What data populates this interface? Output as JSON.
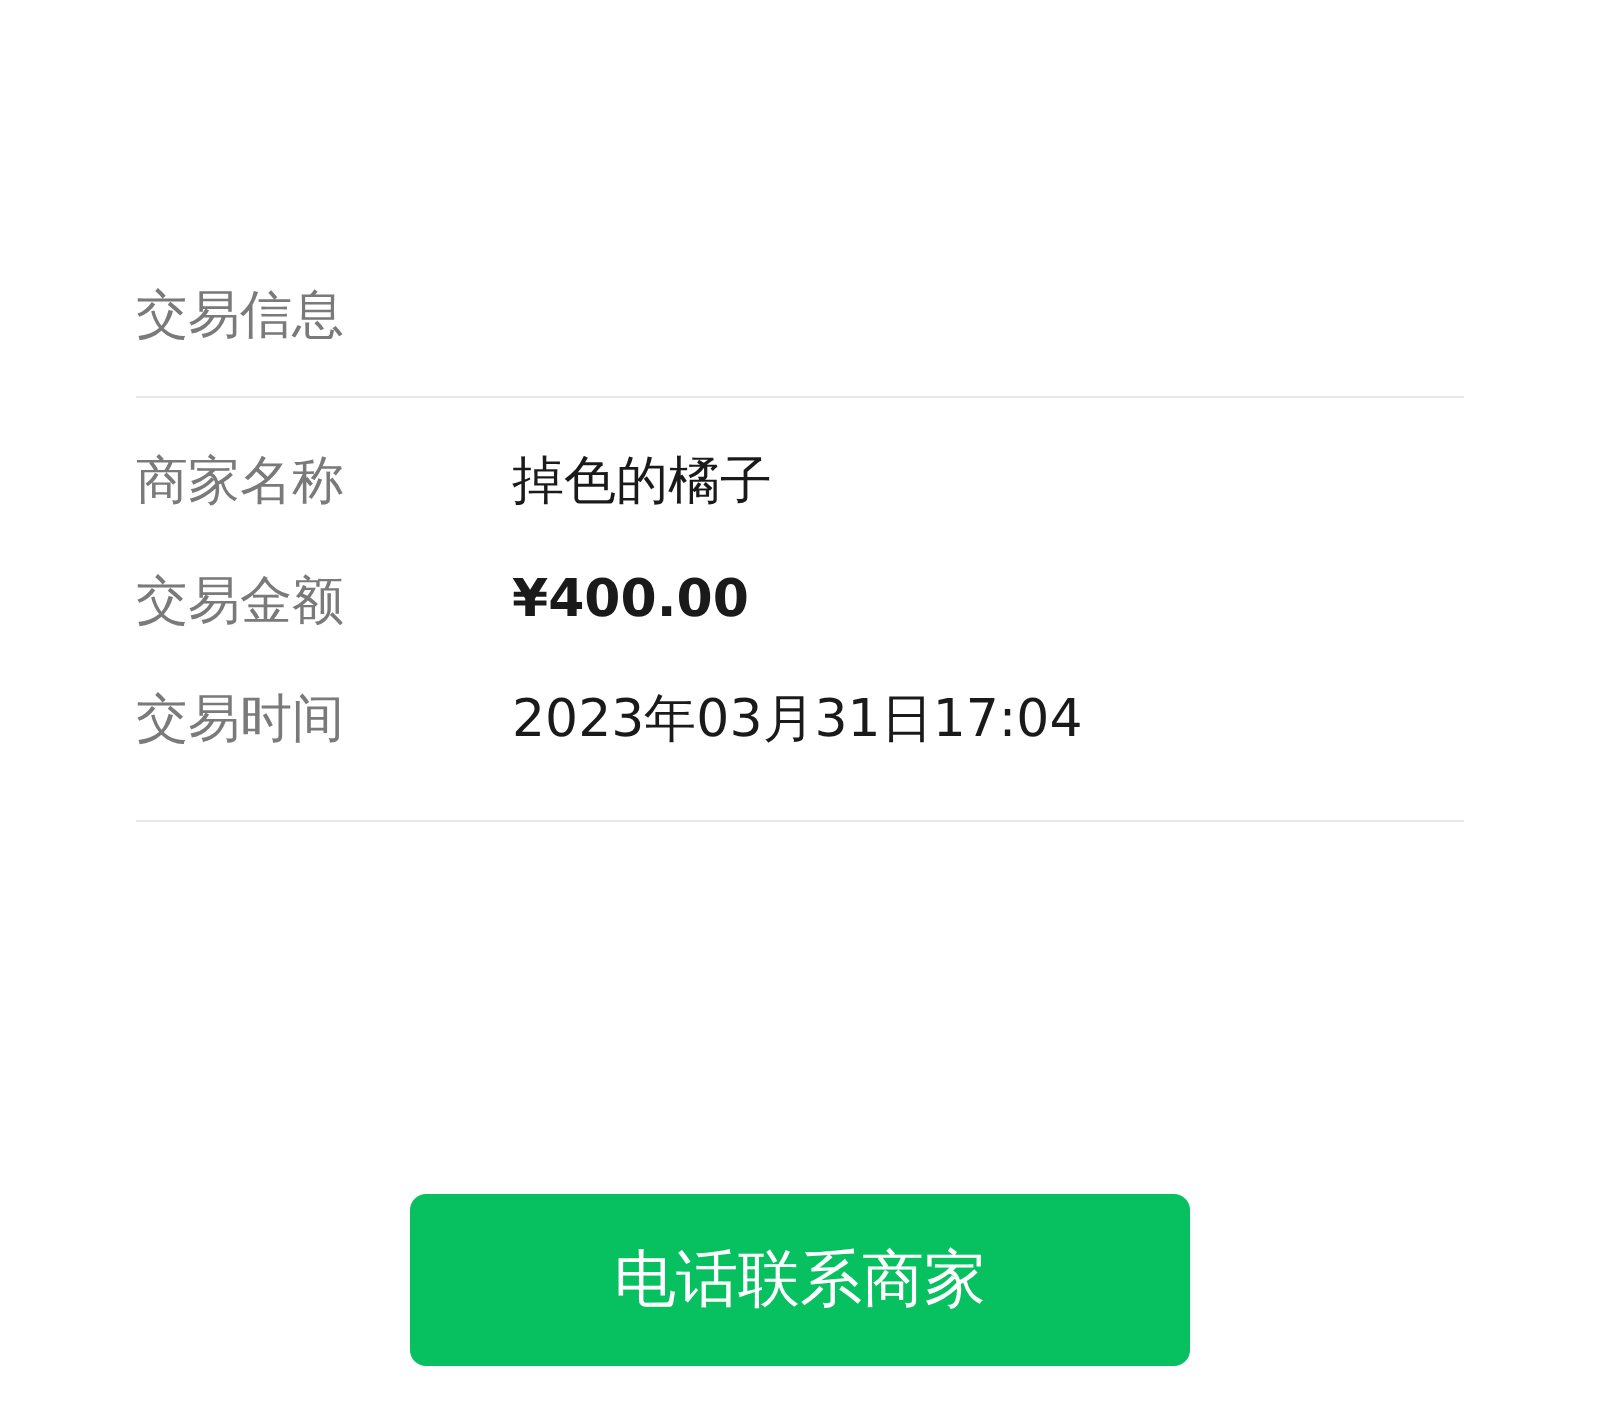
{
  "section_title": "交易信息",
  "rows": [
    {
      "label": "商家名称",
      "value": "掉色的橘子",
      "kind": "text"
    },
    {
      "label": "交易金额",
      "value": "¥400.00",
      "kind": "amount"
    },
    {
      "label": "交易时间",
      "value": "2023年03月31日17:04",
      "kind": "text"
    }
  ],
  "button": "电话联系商家"
}
